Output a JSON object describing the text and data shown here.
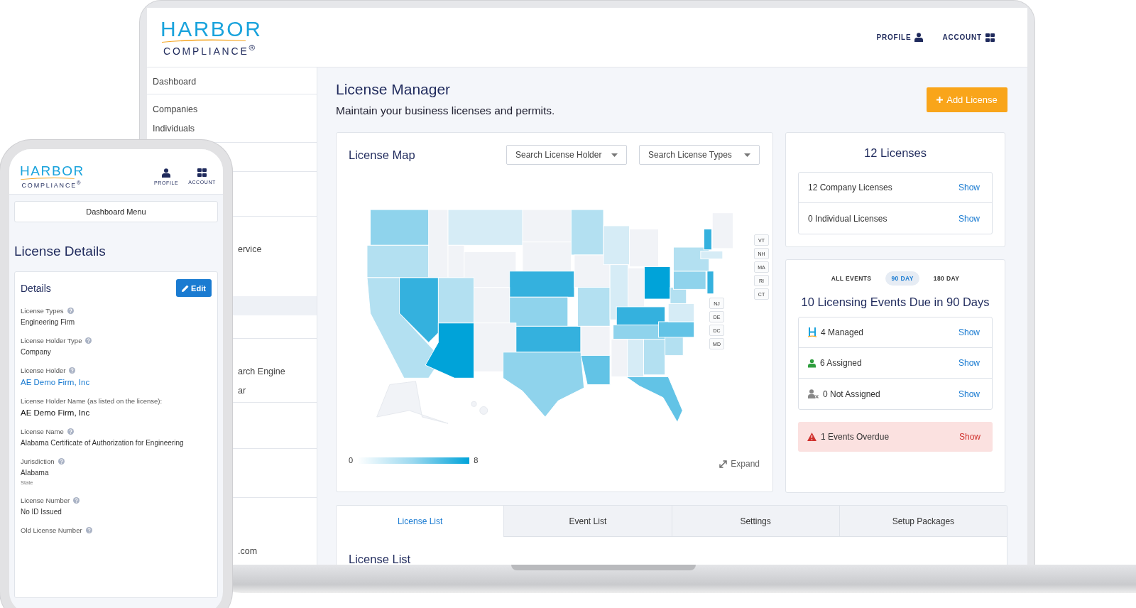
{
  "laptop": {
    "logo": {
      "top": "HARBOR",
      "bottom": "COMPLIANCE$^{®}$"
    },
    "header_links": [
      {
        "kind": "profile",
        "label": "PROFILE"
      },
      {
        "kind": "account",
        "label": "ACCOUNT"
      }
    ],
    "sidebar": {
      "items": [
        "Dashboard",
        "Companies",
        "Individuals",
        "ervice",
        "arch Engine",
        "ar",
        ".com"
      ]
    },
    "title": "License Manager",
    "subtitle": "Maintain your business licenses and permits.",
    "add_button": "Add License",
    "license_map": {
      "title": "License Map",
      "filters": [
        {
          "placeholder": "Search License Holder"
        },
        {
          "placeholder": "Search License Types"
        }
      ],
      "state_tag_groups": [
        {
          "tags": [
            "VT",
            "NH",
            "MA",
            "RI",
            "CT"
          ]
        },
        {
          "tags": [
            "NJ",
            "DE",
            "DC",
            "MD"
          ]
        }
      ],
      "legend": {
        "min": "0",
        "max": "8"
      },
      "expand": "Expand"
    },
    "licenses": {
      "title": "12 Licenses",
      "rows": [
        {
          "label": "12 Company Licenses",
          "action": "Show"
        },
        {
          "label": "0 Individual Licenses",
          "action": "Show"
        }
      ]
    },
    "events": {
      "tabs": [
        {
          "label": "ALL EVENTS",
          "selected": false
        },
        {
          "label": "90 DAY",
          "selected": true
        },
        {
          "label": "180 DAY",
          "selected": false
        }
      ],
      "title": "10 Licensing Events Due in 90 Days",
      "rows": [
        {
          "kind": "managed",
          "label": "4 Managed",
          "action": "Show"
        },
        {
          "kind": "assigned",
          "label": "6 Assigned",
          "action": "Show"
        },
        {
          "kind": "not_assigned",
          "label": "0 Not Assigned",
          "action": "Show"
        }
      ],
      "overdue": {
        "label": "1 Events Overdue",
        "action": "Show"
      }
    },
    "tabs": [
      {
        "label": "License List",
        "selected": true
      },
      {
        "label": "Event List",
        "selected": false
      },
      {
        "label": "Settings",
        "selected": false
      },
      {
        "label": "Setup Packages",
        "selected": false
      }
    ],
    "list_title": "License List"
  },
  "phone": {
    "logo": {
      "top": "HARBOR",
      "bottom": "COMPLIANCE$^{®}$"
    },
    "header_links": [
      {
        "kind": "profile",
        "label": "PROFILE"
      },
      {
        "kind": "account",
        "label": "ACCOUNT"
      }
    ],
    "menu_button": "Dashboard Menu",
    "title": "License Details",
    "card_title": "Details",
    "edit_button": "Edit",
    "fields": [
      {
        "label": "License Types",
        "help": true,
        "kind": "text",
        "value": "Engineering Firm"
      },
      {
        "label": "License Holder Type",
        "help": true,
        "kind": "text",
        "value": "Company"
      },
      {
        "label": "License Holder",
        "help": true,
        "kind": "link",
        "value": "AE Demo Firm, Inc"
      },
      {
        "label": "License Holder Name (as listed on the license):",
        "help": false,
        "kind": "large",
        "value": "AE Demo Firm, Inc"
      },
      {
        "label": "License Name",
        "help": true,
        "kind": "text",
        "value": "Alabama Certificate of Authorization for Engineering"
      },
      {
        "label": "Jurisdiction",
        "help": true,
        "kind": "text",
        "value": "Alabama",
        "note": "State"
      },
      {
        "label": "License Number",
        "help": true,
        "kind": "text",
        "value": "No ID Issued"
      },
      {
        "label": "Old License Number",
        "help": true,
        "kind": "text"
      }
    ]
  }
}
